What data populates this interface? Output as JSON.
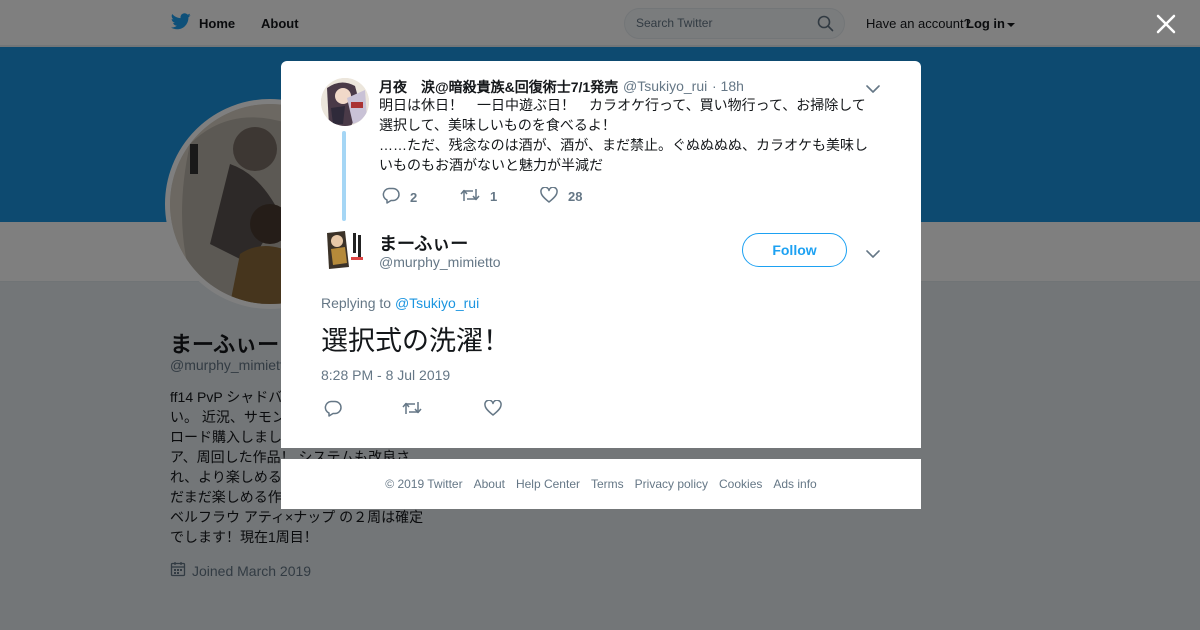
{
  "topbar": {
    "home_label": "Home",
    "about_label": "About",
    "search_placeholder": "Search Twitter",
    "have_account": "Have an account?",
    "login_label": "Log in"
  },
  "profile": {
    "name": "まーふぃー",
    "handle": "@murphy_mimiett",
    "bio": [
      "ff14 PvP シャドバ",
      "い。 近況、サモン",
      "ロード購入しまし",
      "ア、周回した作品！ システムも改良さ",
      "れ、より楽しめる",
      "だまだ楽しめる作",
      "ベルフラウ アティ×ナップ の２周は確定",
      "でします！現在1周目！"
    ],
    "joined": "Joined March 2019"
  },
  "parent_tweet": {
    "name": "月夜　涙@暗殺貴族&回復術士7/1発売",
    "handle": "@Tsukiyo_rui",
    "time": "· 18h",
    "text_lines": [
      "明日は休日！　一日中遊ぶ日！　カラオケ行って、買い物行って、お掃除して",
      "選択して、美味しいものを食べるよ！",
      "……ただ、残念なのは酒が、酒が、まだ禁止。ぐぬぬぬぬ、カラオケも美味し",
      "いものもお酒がないと魅力が半減だ"
    ],
    "replies": "2",
    "retweets": "1",
    "likes": "28"
  },
  "main_tweet": {
    "name": "まーふぃー",
    "handle": "@murphy_mimietto",
    "follow_label": "Follow",
    "replying_prefix": "Replying to",
    "replying_to": "@Tsukiyo_rui",
    "text": "選択式の洗濯！",
    "timestamp": "8:28 PM - 8 Jul 2019"
  },
  "footer": {
    "items": [
      "© 2019 Twitter",
      "About",
      "Help Center",
      "Terms",
      "Privacy policy",
      "Cookies",
      "Ads info"
    ]
  },
  "colors": {
    "brand": "#1da1f2",
    "banner": "#1b95e0",
    "muted": "#657786",
    "overlay": "rgba(0,0,0,0.5)"
  }
}
